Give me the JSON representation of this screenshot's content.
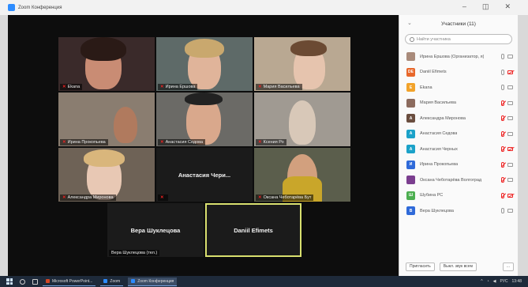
{
  "window": {
    "title": "Zoom Конференция"
  },
  "tiles": [
    {
      "name": "Ekana"
    },
    {
      "name": "Ирина Ершова"
    },
    {
      "name": "Мария Васильева"
    },
    {
      "name": "Ирина Прокопьева"
    },
    {
      "name": "Анастасия Седова"
    },
    {
      "name": "Ксения Ро"
    },
    {
      "name": "Александра Миронова"
    },
    {
      "big": "Анастасия Чери..."
    },
    {
      "name": "Оксана Чеботарёва Бут"
    },
    {
      "big": "Вера Шуклецова",
      "name": "Вера Шуклецова (тел.)"
    },
    {
      "big": "Daniil Efimets"
    }
  ],
  "participants": {
    "header": "Участники (11)",
    "search_placeholder": "Найти участника",
    "items": [
      {
        "initials": "",
        "name": "Ирина Ершова (Организатор, я)",
        "color": "#a98b7b",
        "mic_muted": false,
        "cam_off": false
      },
      {
        "initials": "DE",
        "name": "Daniil Efimets",
        "color": "#e8672a",
        "mic_muted": false,
        "cam_off": true
      },
      {
        "initials": "E",
        "name": "Ekana",
        "color": "#f2a32b",
        "mic_muted": false,
        "cam_off": false
      },
      {
        "initials": "",
        "name": "Мария Васильева",
        "color": "#8c6b5e",
        "mic_muted": true,
        "cam_off": false
      },
      {
        "initials": "A",
        "name": "Александра Миронова",
        "color": "#6a4d3f",
        "mic_muted": true,
        "cam_off": false
      },
      {
        "initials": "A",
        "name": "Анастасия Седова",
        "color": "#1ba2c9",
        "mic_muted": true,
        "cam_off": false
      },
      {
        "initials": "A",
        "name": "Анастасия Черных",
        "color": "#1ba2c9",
        "mic_muted": true,
        "cam_off": true
      },
      {
        "initials": "И",
        "name": "Ирина Прокопьева",
        "color": "#2f6ad9",
        "mic_muted": true,
        "cam_off": false
      },
      {
        "initials": "",
        "name": "Оксана Чеботарёва Волгоград",
        "color": "#7b3e8f",
        "mic_muted": true,
        "cam_off": false
      },
      {
        "initials": "Ш",
        "name": "Шубина РС",
        "color": "#4cae50",
        "mic_muted": true,
        "cam_off": true
      },
      {
        "initials": "B",
        "name": "Вера Шуклецова",
        "color": "#2f6ad9",
        "mic_muted": false,
        "cam_off": false
      }
    ],
    "invite_label": "Пригласить",
    "mute_all_label": "Выкл. звук всем",
    "more_label": "..."
  },
  "taskbar": {
    "apps": [
      {
        "label": "Microsoft PowerPoint...",
        "color": "#d24726"
      },
      {
        "label": "Zoom",
        "color": "#2d8cff"
      },
      {
        "label": "Zoom Конференция",
        "color": "#2d8cff"
      }
    ],
    "tray": {
      "lang": "РУС",
      "time": "13:48"
    }
  },
  "colors": {
    "accent": "#2d8cff",
    "active_speaker_border": "#d9e06f",
    "muted_red": "#e22222"
  }
}
